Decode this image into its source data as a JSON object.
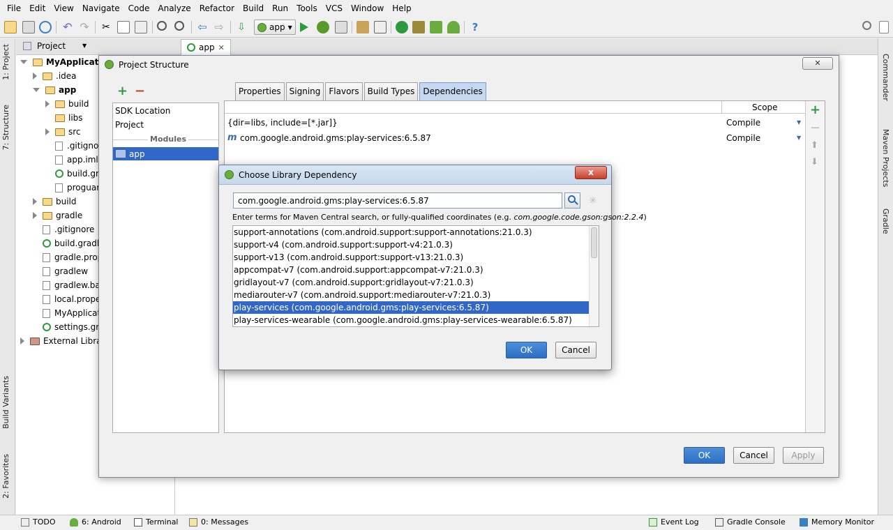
{
  "menu": [
    "File",
    "Edit",
    "View",
    "Navigate",
    "Code",
    "Analyze",
    "Refactor",
    "Build",
    "Run",
    "Tools",
    "VCS",
    "Window",
    "Help"
  ],
  "toolbar": {
    "run_config": "app"
  },
  "left_stripe": {
    "project": "1: Project",
    "structure": "7: Structure",
    "build_variants": "Build Variants",
    "favorites": "2: Favorites"
  },
  "right_stripe": {
    "commander": "Commander",
    "maven": "Maven Projects",
    "gradle": "Gradle"
  },
  "project_panel": {
    "title": "Project"
  },
  "editor": {
    "tab": "app"
  },
  "tree": [
    {
      "label": "MyApplication",
      "depth": 0,
      "type": "root"
    },
    {
      "label": ".idea",
      "depth": 1,
      "type": "folder"
    },
    {
      "label": "app",
      "depth": 1,
      "type": "module"
    },
    {
      "label": "build",
      "depth": 2,
      "type": "folder"
    },
    {
      "label": "libs",
      "depth": 2,
      "type": "folder"
    },
    {
      "label": "src",
      "depth": 2,
      "type": "folder"
    },
    {
      "label": ".gitignore",
      "depth": 2,
      "type": "file"
    },
    {
      "label": "app.iml",
      "depth": 2,
      "type": "file"
    },
    {
      "label": "build.gradle",
      "depth": 2,
      "type": "gradle"
    },
    {
      "label": "proguard-rules.pro",
      "depth": 2,
      "type": "file"
    },
    {
      "label": "build",
      "depth": 1,
      "type": "folder"
    },
    {
      "label": "gradle",
      "depth": 1,
      "type": "folder"
    },
    {
      "label": ".gitignore",
      "depth": 1,
      "type": "file"
    },
    {
      "label": "build.gradle",
      "depth": 1,
      "type": "gradle"
    },
    {
      "label": "gradle.properties",
      "depth": 1,
      "type": "file"
    },
    {
      "label": "gradlew",
      "depth": 1,
      "type": "file"
    },
    {
      "label": "gradlew.bat",
      "depth": 1,
      "type": "file"
    },
    {
      "label": "local.properties",
      "depth": 1,
      "type": "file"
    },
    {
      "label": "MyApplication.iml",
      "depth": 1,
      "type": "file"
    },
    {
      "label": "settings.gradle",
      "depth": 1,
      "type": "gradle"
    },
    {
      "label": "External Libraries",
      "depth": 0,
      "type": "lib"
    }
  ],
  "project_structure": {
    "title": "Project Structure",
    "close_label": "✕",
    "sidebar": {
      "sdk_location": "SDK Location",
      "project": "Project",
      "modules_header": "Modules",
      "module": "app"
    },
    "tabs": [
      "Properties",
      "Signing",
      "Flavors",
      "Build Types",
      "Dependencies"
    ],
    "active_tab": "Dependencies",
    "scope_header": "Scope",
    "dependencies": [
      {
        "name": "{dir=libs, include=[*.jar]}",
        "scope": "Compile"
      },
      {
        "name": "com.google.android.gms:play-services:6.5.87",
        "scope": "Compile"
      }
    ],
    "ok": "OK",
    "cancel": "Cancel",
    "apply": "Apply"
  },
  "choose_library": {
    "title": "Choose Library Dependency",
    "close_label": "x",
    "query": "com.google.android.gms:play-services:6.5.87",
    "hint_prefix": "Enter terms for Maven Central search, or fully-qualified coordinates (e.g. ",
    "hint_example": "com.google.code.gson:gson:2.2.4",
    "hint_suffix": ")",
    "results": [
      "support-annotations (com.android.support:support-annotations:21.0.3)",
      "support-v4 (com.android.support:support-v4:21.0.3)",
      "support-v13 (com.android.support:support-v13:21.0.3)",
      "appcompat-v7 (com.android.support:appcompat-v7:21.0.3)",
      "gridlayout-v7 (com.android.support:gridlayout-v7:21.0.3)",
      "mediarouter-v7 (com.android.support:mediarouter-v7:21.0.3)",
      "play-services (com.google.android.gms:play-services:6.5.87)",
      "play-services-wearable (com.google.android.gms:play-services-wearable:6.5.87)"
    ],
    "selected_index": 6,
    "ok": "OK",
    "cancel": "Cancel"
  },
  "statusbar": {
    "todo": "TODO",
    "android": "6: Android",
    "terminal": "Terminal",
    "messages": "0: Messages",
    "event_log": "Event Log",
    "gradle_console": "Gradle Console",
    "memory_monitor": "Memory Monitor"
  },
  "colors": {
    "selection": "#3168c8",
    "accent_green": "#2e9a3e",
    "primary_button": "#2c6fc4"
  }
}
